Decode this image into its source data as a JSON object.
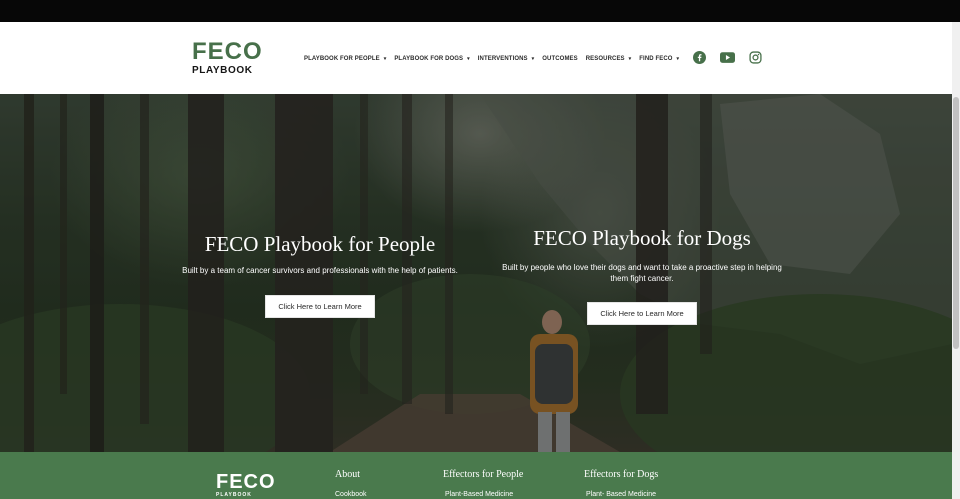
{
  "logo": {
    "top": "FECO",
    "bottom": "PLAYBOOK"
  },
  "nav": {
    "items": [
      {
        "label": "PLAYBOOK FOR PEOPLE",
        "caret": "▾"
      },
      {
        "label": "PLAYBOOK FOR DOGS",
        "caret": "▾"
      },
      {
        "label": "INTERVENTIONS",
        "caret": "▾"
      },
      {
        "label": "OUTCOMES",
        "caret": ""
      },
      {
        "label": "RESOURCES",
        "caret": "▾"
      },
      {
        "label": "FIND FECO",
        "caret": "▾"
      }
    ]
  },
  "socials": [
    "facebook-icon",
    "youtube-icon",
    "instagram-icon"
  ],
  "colors": {
    "brand_green": "#47704a",
    "footer_green": "#4a7a4d"
  },
  "hero": {
    "people": {
      "title": "FECO Playbook for People",
      "description": "Built by a team of cancer survivors and professionals with the help of patients.",
      "button": "Click Here to Learn More"
    },
    "dogs": {
      "title": "FECO Playbook for Dogs",
      "description_line1": "Built by people who love their dogs and want to take a proactive step in helping",
      "description_line2": "them fight cancer.",
      "button": "Click Here to Learn More"
    }
  },
  "footer": {
    "logo_top": "FECO",
    "logo_bottom": "PLAYBOOK",
    "columns": [
      {
        "heading": "About",
        "link": "Cookbook"
      },
      {
        "heading": "Effectors for People",
        "link": "Plant-Based Medicine"
      },
      {
        "heading": "Effectors for Dogs",
        "link": "Plant- Based Medicine"
      }
    ]
  }
}
